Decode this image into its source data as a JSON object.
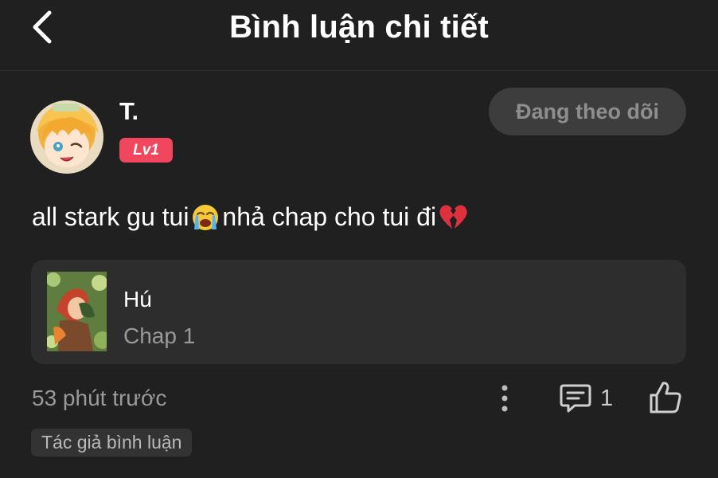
{
  "header": {
    "title": "Bình luận chi tiết",
    "back_icon": "chevron-left-icon"
  },
  "comment": {
    "username": "T.",
    "level": "Lv1",
    "follow_label": "Đang theo dõi",
    "text_part1": "all stark gu tui",
    "emoji1": "😭",
    "text_part2": "nhả chap cho tui đi",
    "emoji2": "💔",
    "timestamp": "53 phút trước",
    "reply_count": "1",
    "author_tag": "Tác giả bình luận"
  },
  "chapter_card": {
    "story_title": "Hú",
    "chapter": "Chap 1"
  },
  "colors": {
    "background": "#202020",
    "card": "#2d2d2d",
    "level_badge": "#f0465e",
    "follow_button": "#3d3d3d",
    "muted_text": "#9a9a9a"
  },
  "icons": {
    "more": "more-vertical-icon",
    "reply": "comment-icon",
    "like": "thumbs-up-icon"
  }
}
